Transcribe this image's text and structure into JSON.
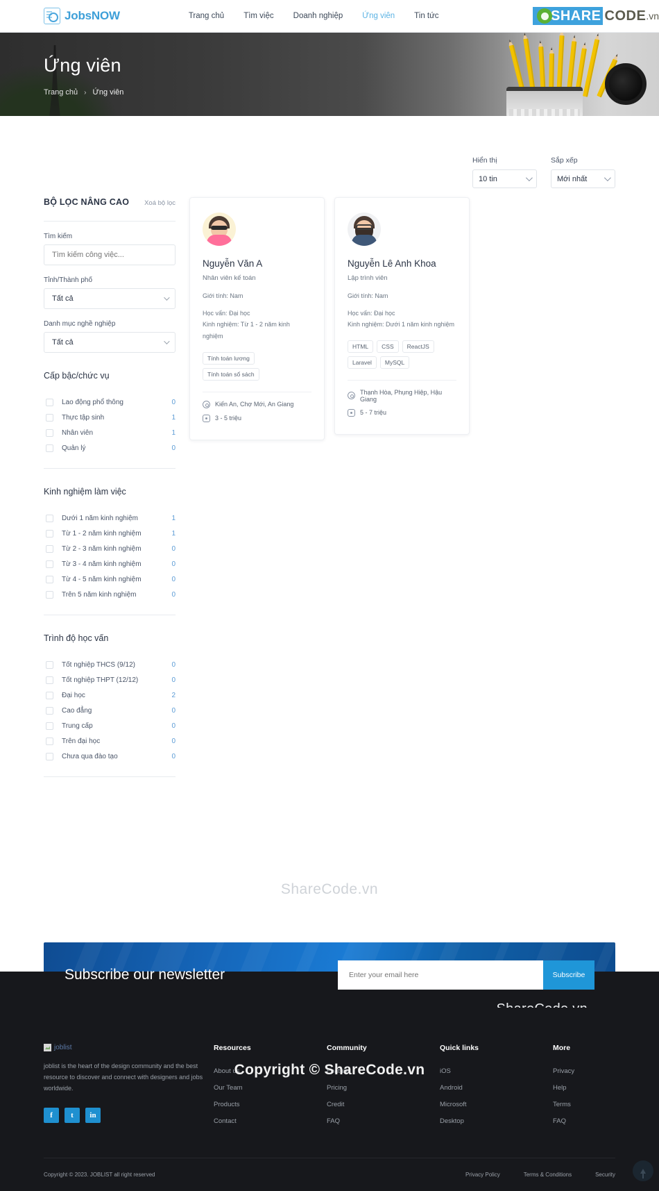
{
  "header": {
    "brand": "JobsNOW",
    "nav": [
      {
        "label": "Trang chủ",
        "active": false
      },
      {
        "label": "Tìm việc",
        "active": false
      },
      {
        "label": "Doanh nghiệp",
        "active": false
      },
      {
        "label": "Ứng viên",
        "active": true
      },
      {
        "label": "Tin tức",
        "active": false
      }
    ],
    "watermark": {
      "part1": "SHARE",
      "part2": "CODE",
      "part3": ".vn"
    }
  },
  "hero": {
    "title": "Ứng viên",
    "breadcrumb_home": "Trang chủ",
    "breadcrumb_sep": "›",
    "breadcrumb_current": "Ứng viên"
  },
  "toolbar": {
    "show_label": "Hiển thị",
    "show_value": "10 tin",
    "sort_label": "Sắp xếp",
    "sort_value": "Mới nhất"
  },
  "sidebar": {
    "title": "BỘ LỌC NÂNG CAO",
    "clear": "Xoá bộ lọc",
    "search_label": "Tìm kiếm",
    "search_placeholder": "Tìm kiếm công việc...",
    "search_value": "",
    "province_label": "Tỉnh/Thành phố",
    "province_value": "Tất cả",
    "category_label": "Danh mục nghề nghiệp",
    "category_value": "Tất cả",
    "groups": [
      {
        "title": "Cấp bậc/chức vụ",
        "items": [
          {
            "label": "Lao động phổ thông",
            "count": "0"
          },
          {
            "label": "Thực tập sinh",
            "count": "1"
          },
          {
            "label": "Nhân viên",
            "count": "1"
          },
          {
            "label": "Quản lý",
            "count": "0"
          }
        ]
      },
      {
        "title": "Kinh nghiệm làm việc",
        "items": [
          {
            "label": "Dưới 1 năm kinh nghiệm",
            "count": "1"
          },
          {
            "label": "Từ 1 - 2 năm kinh nghiệm",
            "count": "1"
          },
          {
            "label": "Từ 2 - 3 năm kinh nghiệm",
            "count": "0"
          },
          {
            "label": "Từ 3 - 4 năm kinh nghiệm",
            "count": "0"
          },
          {
            "label": "Từ 4 - 5 năm kinh nghiệm",
            "count": "0"
          },
          {
            "label": "Trên 5 năm kinh nghiệm",
            "count": "0"
          }
        ]
      },
      {
        "title": "Trình độ học vấn",
        "items": [
          {
            "label": "Tốt nghiệp THCS (9/12)",
            "count": "0"
          },
          {
            "label": "Tốt nghiệp THPT (12/12)",
            "count": "0"
          },
          {
            "label": "Đại học",
            "count": "2"
          },
          {
            "label": "Cao đẳng",
            "count": "0"
          },
          {
            "label": "Trung cấp",
            "count": "0"
          },
          {
            "label": "Trên đại học",
            "count": "0"
          },
          {
            "label": "Chưa qua đào tạo",
            "count": "0"
          }
        ]
      }
    ]
  },
  "candidates": [
    {
      "name": "Nguyễn Văn A",
      "role": "Nhân viên kế toán",
      "gender": "Giới tính: Nam",
      "education": "Học vấn: Đại học",
      "experience": "Kinh nghiệm: Từ 1 - 2 năm kinh nghiệm",
      "tags": [
        "Tính toán lương",
        "Tính toán sổ sách"
      ],
      "location": "Kiến An, Chợ Mới, An Giang",
      "salary": "3 - 5 triệu"
    },
    {
      "name": "Nguyễn Lê Anh Khoa",
      "role": "Lập trình viên",
      "gender": "Giới tính: Nam",
      "education": "Học vấn: Đại học",
      "experience": "Kinh nghiệm: Dưới 1 năm kinh nghiệm",
      "tags": [
        "HTML",
        "CSS",
        "ReactJS",
        "Laravel",
        "MySQL"
      ],
      "location": "Thạnh Hòa, Phụng Hiệp, Hậu Giang",
      "salary": "5 - 7 triệu"
    }
  ],
  "watermark_mid": "ShareCode.vn",
  "newsletter": {
    "title": "Subscribe our newsletter",
    "placeholder": "Enter your email here",
    "value": "",
    "button": "Subscribe",
    "watermark": "ShareCode.vn"
  },
  "footer": {
    "logo_alt": "joblist",
    "description": "joblist is the heart of the design community and the best resource to discover and connect with designers and jobs worldwide.",
    "social": [
      {
        "name": "facebook",
        "glyph": "f"
      },
      {
        "name": "twitter",
        "glyph": "t"
      },
      {
        "name": "linkedin",
        "glyph": "in"
      }
    ],
    "columns": [
      {
        "title": "Resources",
        "links": [
          "About us",
          "Our Team",
          "Products",
          "Contact"
        ]
      },
      {
        "title": "Community",
        "links": [
          "Feature",
          "Pricing",
          "Credit",
          "FAQ"
        ]
      },
      {
        "title": "Quick links",
        "links": [
          "iOS",
          "Android",
          "Microsoft",
          "Desktop"
        ]
      },
      {
        "title": "More",
        "links": [
          "Privacy",
          "Help",
          "Terms",
          "FAQ"
        ]
      }
    ],
    "copyright": "Copyright © 2023. JOBLIST all right reserved",
    "legal": [
      "Privacy Policy",
      "Terms & Conditions",
      "Security"
    ],
    "watermark": "Copyright © ShareCode.vn"
  }
}
